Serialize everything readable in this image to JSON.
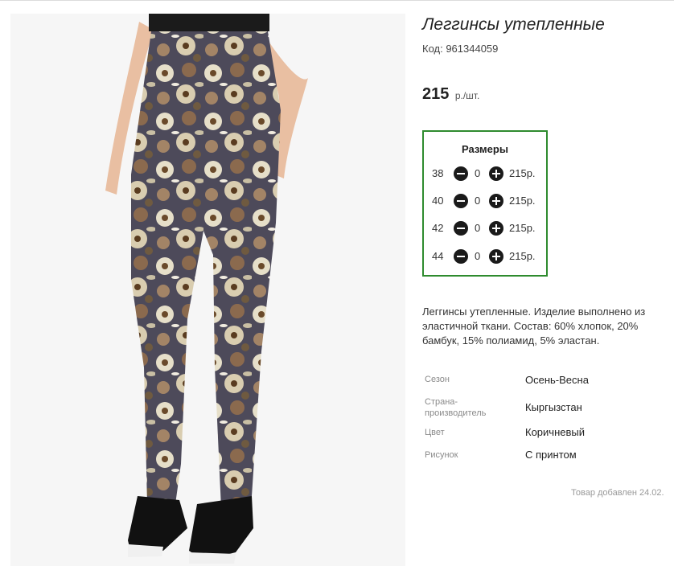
{
  "product": {
    "title": "Леггинсы утепленные",
    "code": "Код: 961344059",
    "price_amount": "215",
    "price_unit": "р./шт.",
    "image_alt_icon": "product-photo-leggings"
  },
  "sizes": {
    "title": "Размеры",
    "rows": [
      {
        "size": "38",
        "qty": "0",
        "price": "215р."
      },
      {
        "size": "40",
        "qty": "0",
        "price": "215р."
      },
      {
        "size": "42",
        "qty": "0",
        "price": "215р."
      },
      {
        "size": "44",
        "qty": "0",
        "price": "215р."
      }
    ]
  },
  "description": "Леггинсы утепленные. Изделие выполнено из эластичной ткани. Состав: 60% хлопок, 20% бамбук, 15% полиамид, 5% эластан.",
  "specs": [
    {
      "key": "Сезон",
      "value": "Осень-Весна"
    },
    {
      "key": "Страна-производитель",
      "value": "Кыргызстан"
    },
    {
      "key": "Цвет",
      "value": "Коричневый"
    },
    {
      "key": "Рисунок",
      "value": "С принтом"
    }
  ],
  "added": "Товар добавлен 24.02.",
  "colors": {
    "sizes_border": "#2e8b2e",
    "button": "#1a1a1a"
  }
}
